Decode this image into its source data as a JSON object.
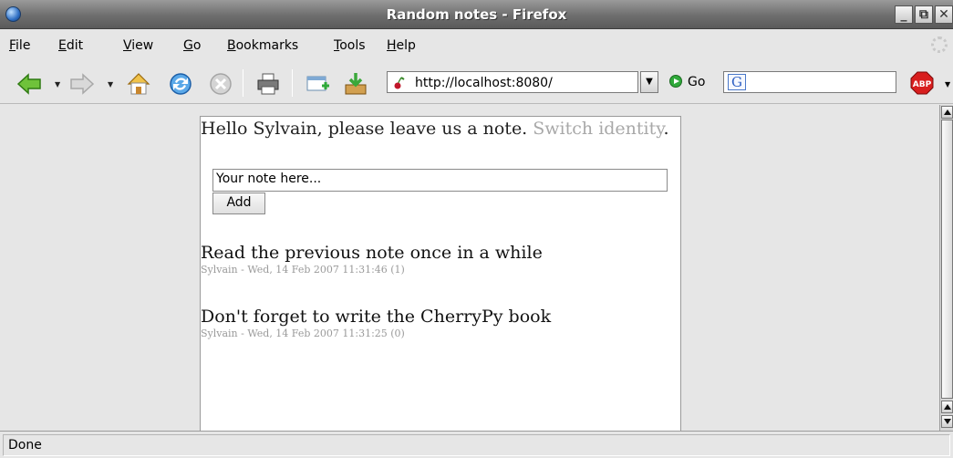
{
  "window": {
    "title": "Random notes - Firefox",
    "minimize": "_",
    "maximize": "⧉",
    "close": "✕"
  },
  "menu": {
    "items": [
      {
        "label": "File",
        "mnemonic": "F",
        "rest": "ile"
      },
      {
        "label": "Edit",
        "mnemonic": "E",
        "rest": "dit"
      },
      {
        "label": "View",
        "mnemonic": "V",
        "rest": "iew"
      },
      {
        "label": "Go",
        "mnemonic": "G",
        "rest": "o"
      },
      {
        "label": "Bookmarks",
        "mnemonic": "B",
        "rest": "ookmarks"
      },
      {
        "label": "Tools",
        "mnemonic": "T",
        "rest": "ools"
      },
      {
        "label": "Help",
        "mnemonic": "H",
        "rest": "elp"
      }
    ]
  },
  "toolbar": {
    "url": "http://localhost:8080/",
    "go_label": "Go",
    "search_engine": "G",
    "adblock_label": "ABP"
  },
  "page": {
    "greeting": "Hello Sylvain, please leave us a note.",
    "switch_link": "Switch identity",
    "period": ".",
    "note_input_value": "Your note here...",
    "add_button": "Add",
    "notes": [
      {
        "text": "Read the previous note once in a while",
        "meta": "Sylvain - Wed, 14 Feb 2007 11:31:46 (1)"
      },
      {
        "text": "Don't forget to write the CherryPy book",
        "meta": "Sylvain - Wed, 14 Feb 2007 11:31:25 (0)"
      }
    ]
  },
  "status": {
    "text": "Done"
  },
  "colors": {
    "link_gray": "#a8a8a8",
    "meta_gray": "#9a9a9a",
    "go_green": "#2fa93a",
    "abp_red": "#d81e1e"
  }
}
